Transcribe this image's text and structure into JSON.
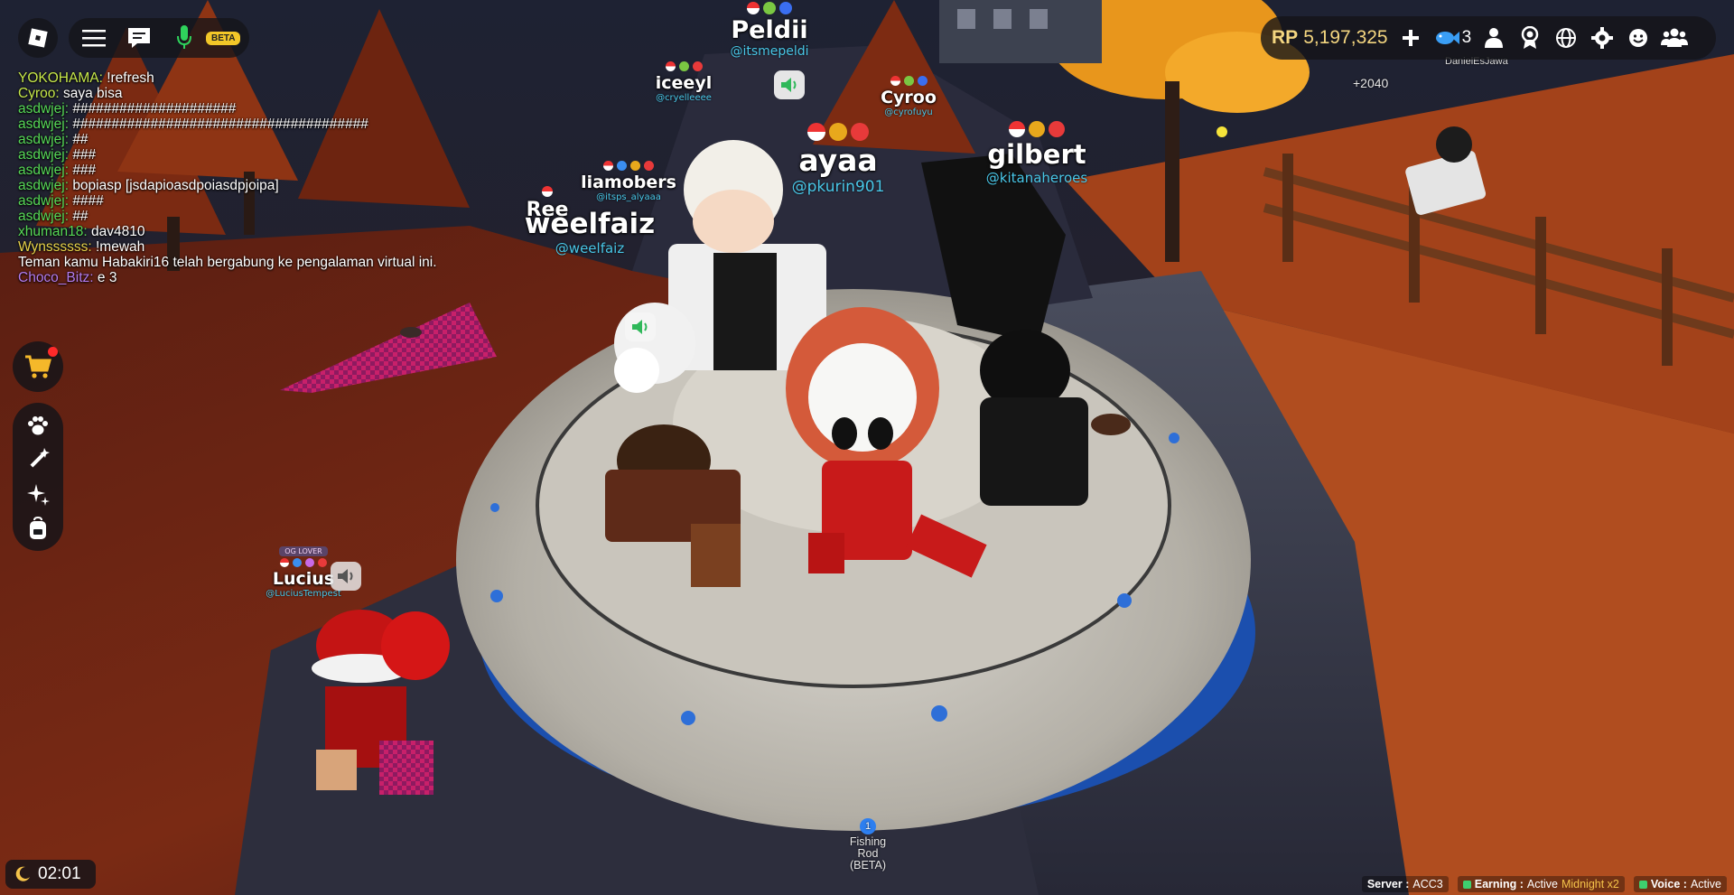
{
  "top_left": {
    "beta_label": "BETA"
  },
  "chat": {
    "lines": [
      {
        "user": "YOKOHAMA:",
        "msg": "!refresh",
        "color": "#c7e84a"
      },
      {
        "user": "Cyroo:",
        "msg": "saya bisa",
        "color": "#c7e84a"
      },
      {
        "user": "asdwjej:",
        "msg": "#####################",
        "color": "#57d957"
      },
      {
        "user": "asdwjej:",
        "msg": "######################################",
        "color": "#57d957"
      },
      {
        "user": "asdwjej:",
        "msg": "##",
        "color": "#57d957"
      },
      {
        "user": "asdwjej:",
        "msg": "###",
        "color": "#57d957"
      },
      {
        "user": "asdwjej:",
        "msg": "###",
        "color": "#57d957"
      },
      {
        "user": "asdwjej:",
        "msg": "bopiasp [jsdapioasdpoiasdpjoipa]",
        "color": "#57d957"
      },
      {
        "user": "asdwjej:",
        "msg": "####",
        "color": "#57d957"
      },
      {
        "user": "asdwjej:",
        "msg": "##",
        "color": "#57d957"
      },
      {
        "user": "xhuman18:",
        "msg": "dav4810",
        "color": "#57d957"
      },
      {
        "user": "Wynssssss:",
        "msg": "!mewah",
        "color": "#e8d34a"
      },
      {
        "user": "",
        "msg": "Teman kamu Habakiri16 telah bergabung ke pengalaman virtual ini.",
        "color": "#ffffff"
      },
      {
        "user": "Choco_Bitz:",
        "msg": "e 3",
        "color": "#b57df0"
      }
    ]
  },
  "top_right": {
    "rp_label": "RP",
    "rp_value": "5,197,325",
    "fish_count": "3",
    "rp_bonus": "+2040",
    "far_player": "DanielEsJawa"
  },
  "clock": {
    "time": "02:01"
  },
  "status": {
    "server_label": "Server :",
    "server_value": "ACC3",
    "earning_label": "Earning :",
    "earning_value": "Active",
    "earning_bonus": "Midnight x2",
    "voice_label": "Voice :",
    "voice_value": "Active"
  },
  "hotbar": {
    "slot_number": "1",
    "item_line1": "Fishing",
    "item_line2": "Rod",
    "item_line3": "(BETA)"
  },
  "players": {
    "peldii": {
      "name": "Peldii",
      "handle": "@itsmepeldi"
    },
    "iceeyl": {
      "name": "iceeyl",
      "handle": "@cryelleeee"
    },
    "cyroo": {
      "name": "Cyroo",
      "handle": "@cyrofuyu"
    },
    "ayaa": {
      "name": "ayaa",
      "handle": "@pkurin901"
    },
    "gilbert": {
      "name": "gilbert",
      "handle": "@kitanaheroes"
    },
    "liamobers": {
      "name": "liamobers",
      "handle": "@itsps_alyaaa"
    },
    "ree": {
      "name": "Ree"
    },
    "weelfaiz": {
      "name": "weelfaiz",
      "handle": "@weelfaiz"
    },
    "lucius": {
      "name": "Lucius",
      "handle": "@LuciusTempest",
      "title": "OG LOVER"
    }
  },
  "colors": {
    "accent_gold": "#f4d680",
    "handle_cyan": "#49c7e8",
    "status_green": "#3ecf6e",
    "slot_blue": "#2d7ff0"
  }
}
